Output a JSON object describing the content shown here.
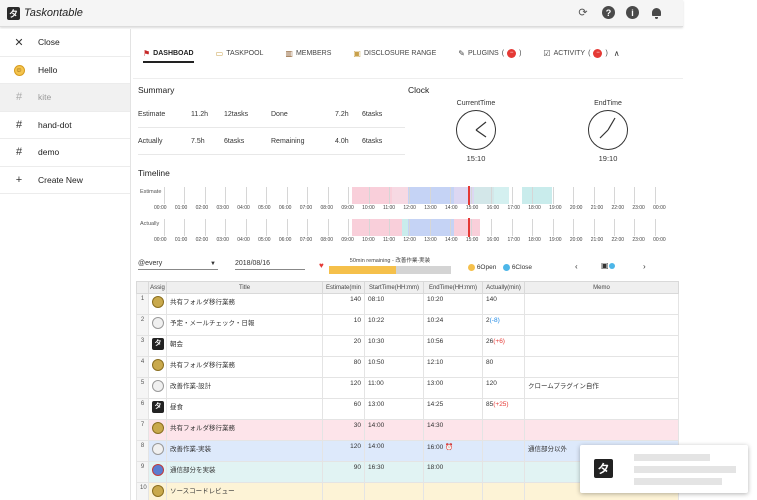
{
  "app": {
    "title": "Taskontable",
    "logo_glyph": "タ"
  },
  "appbar_icons": [
    "sync-icon",
    "help-icon",
    "info-icon",
    "bell-icon"
  ],
  "sidebar": {
    "items": [
      {
        "label": "Close",
        "icon": "close-icon"
      },
      {
        "label": "Hello",
        "icon": "smiley-icon"
      },
      {
        "label": "kite",
        "icon": "hash-icon"
      },
      {
        "label": "hand-dot",
        "icon": "hash-icon"
      },
      {
        "label": "demo",
        "icon": "hash-icon"
      },
      {
        "label": "Create New",
        "icon": "plus-icon"
      }
    ]
  },
  "tabs": [
    {
      "label": "DASHBOAD",
      "icon": "flag-icon"
    },
    {
      "label": "TASKPOOL",
      "icon": "folder-icon"
    },
    {
      "label": "MEMBERS",
      "icon": "members-icon"
    },
    {
      "label": "DISCLOSURE RANGE",
      "icon": "lock-icon"
    },
    {
      "label": "PLUGINS",
      "icon": "plug-icon",
      "badge": "−"
    },
    {
      "label": "ACTIVITY",
      "icon": "activity-icon",
      "badge": "−"
    }
  ],
  "summary": {
    "title": "Summary",
    "rows": [
      {
        "label": "Estimate",
        "time": "11.2h",
        "tasks": "12tasks",
        "label2": "Done",
        "time2": "7.2h",
        "tasks2": "6tasks"
      },
      {
        "label": "Actually",
        "time": "7.5h",
        "tasks": "6tasks",
        "label2": "Remaining",
        "time2": "4.0h",
        "tasks2": "6tasks"
      }
    ]
  },
  "clock": {
    "title": "Clock",
    "current_label": "CurrentTime",
    "current_time": "15:10",
    "end_label": "EndTime",
    "end_time": "19:10"
  },
  "timeline": {
    "title": "Timeline",
    "rows": [
      "Estimate",
      "Actually"
    ],
    "hours": [
      "00:00",
      "01:00",
      "02:00",
      "03:00",
      "04:00",
      "05:00",
      "06:00",
      "07:00",
      "08:00",
      "09:00",
      "10:00",
      "11:00",
      "12:00",
      "13:00",
      "14:00",
      "15:00",
      "16:00",
      "17:00",
      "18:00",
      "19:00",
      "20:00",
      "21:00",
      "22:00",
      "23:00",
      "00:00"
    ],
    "colors": {
      "pink": "#f9cfda",
      "blue": "#c5d3f5",
      "cyan": "#c9ecec",
      "green": "#d6efd2",
      "now": "#e53935"
    }
  },
  "toolbar": {
    "filter": "@every",
    "date": "2018/08/16",
    "progress_label": "50min remaining - 改善作業-実装",
    "progress_fraction": 0.55,
    "open_count": "6Open",
    "close_count": "6Close"
  },
  "table": {
    "headers": [
      "",
      "Assig",
      "Title",
      "Estimate(min",
      "StartTime(HH:mm)",
      "EndTime(HH:mm)",
      "Actually(min)",
      "Memo"
    ],
    "rows": [
      {
        "idx": "1",
        "avatar": "gold",
        "title": "共有フォルダ移行業務",
        "estimate": "140",
        "start": "08:10",
        "end": "10:20",
        "actually": "140",
        "diff": "",
        "memo": "",
        "style": ""
      },
      {
        "idx": "2",
        "avatar": "sketch",
        "title": "予定・メールチェック・日報",
        "estimate": "10",
        "start": "10:22",
        "end": "10:24",
        "actually": "2",
        "diff": "(-8)",
        "memo": "",
        "style": ""
      },
      {
        "idx": "3",
        "avatar": "logo",
        "title": "朝会",
        "estimate": "20",
        "start": "10:30",
        "end": "10:56",
        "actually": "26",
        "diff": "(+6)",
        "memo": "",
        "style": ""
      },
      {
        "idx": "4",
        "avatar": "gold",
        "title": "共有フォルダ移行業務",
        "estimate": "80",
        "start": "10:50",
        "end": "12:10",
        "actually": "80",
        "diff": "",
        "memo": "",
        "style": ""
      },
      {
        "idx": "5",
        "avatar": "sketch",
        "title": "改善作業-設計",
        "estimate": "120",
        "start": "11:00",
        "end": "13:00",
        "actually": "120",
        "diff": "",
        "memo": "クロームプラグイン自作",
        "style": ""
      },
      {
        "idx": "6",
        "avatar": "logo",
        "title": "昼食",
        "estimate": "60",
        "start": "13:00",
        "end": "14:25",
        "actually": "85",
        "diff": "(+25)",
        "memo": "",
        "style": ""
      },
      {
        "idx": "7",
        "avatar": "gold",
        "title": "共有フォルダ移行業務",
        "estimate": "30",
        "start": "14:00",
        "end": "14:30",
        "actually": "",
        "diff": "",
        "memo": "",
        "style": "pink"
      },
      {
        "idx": "8",
        "avatar": "sketch",
        "title": "改善作業-実装",
        "estimate": "120",
        "start": "14:00",
        "end": "16:00",
        "actually": "",
        "diff": "",
        "memo": "通信部分以外",
        "style": "blue"
      },
      {
        "idx": "9",
        "avatar": "face",
        "title": "通信部分を実装",
        "estimate": "90",
        "start": "16:30",
        "end": "18:00",
        "actually": "",
        "diff": "",
        "memo": "",
        "style": "cyan"
      },
      {
        "idx": "10",
        "avatar": "gold",
        "title": "ソースコードレビュー",
        "estimate": "",
        "start": "",
        "end": "",
        "actually": "",
        "diff": "",
        "memo": "",
        "style": "yellow"
      }
    ]
  },
  "toast": {
    "logo_glyph": "タ"
  }
}
